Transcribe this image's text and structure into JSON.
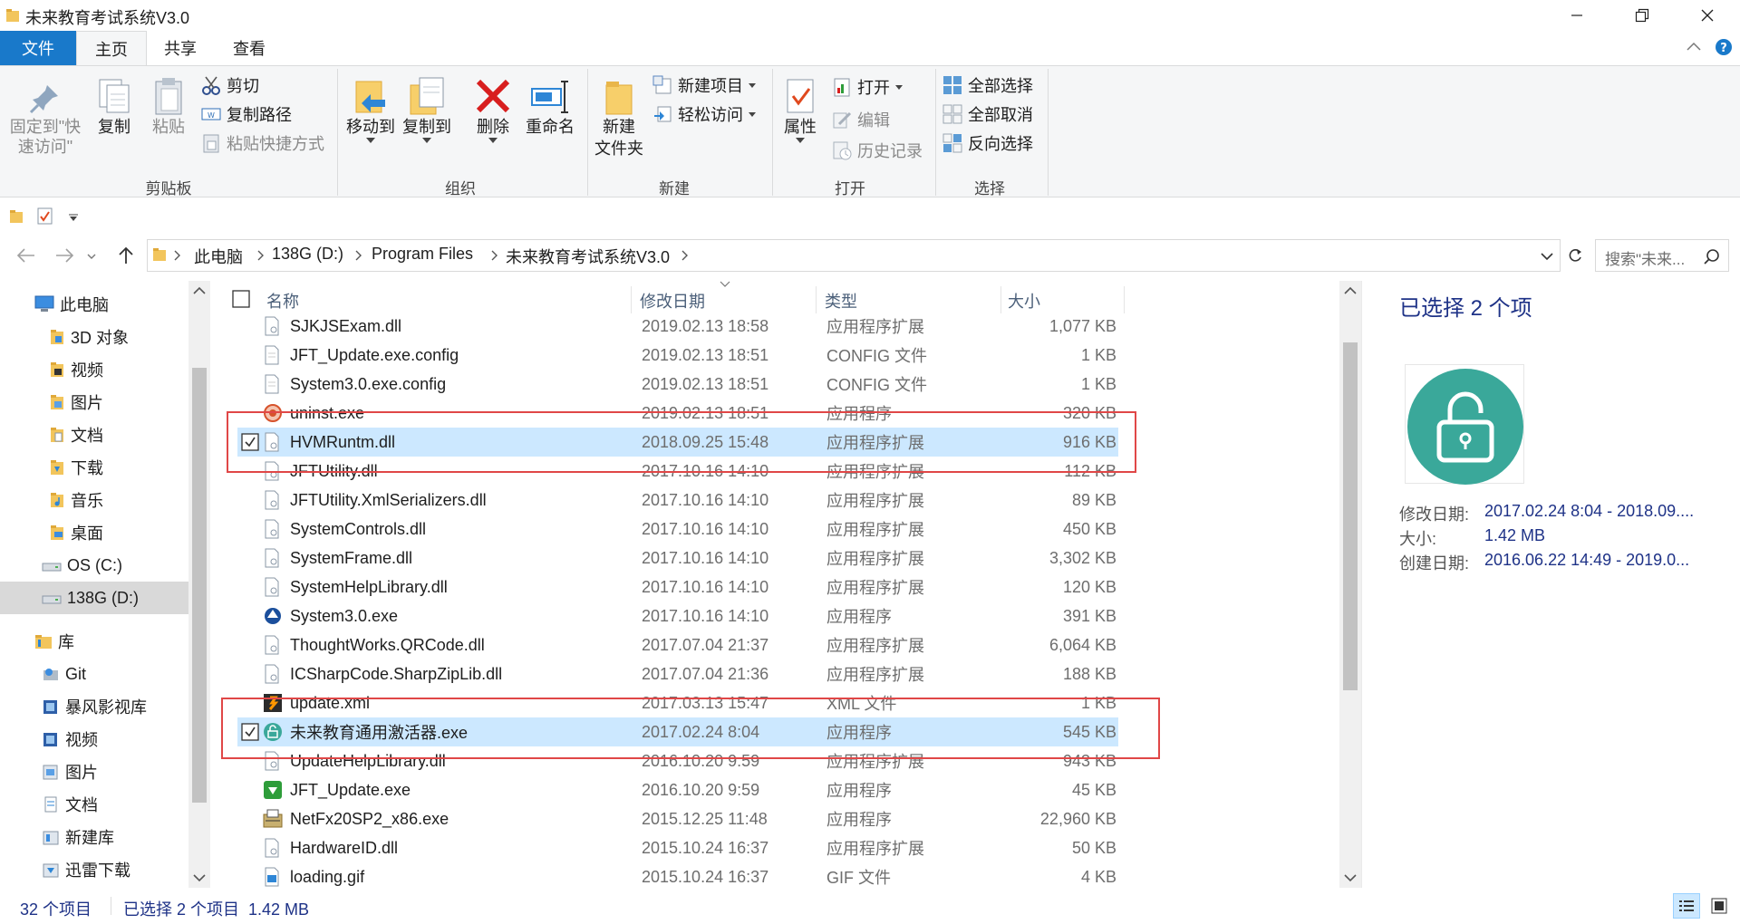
{
  "window": {
    "title": "未来教育考试系统V3.0"
  },
  "tabs": {
    "file": "文件",
    "home": "主页",
    "share": "共享",
    "view": "查看"
  },
  "ribbon": {
    "clipboard": {
      "label": "剪贴板",
      "pin_line1": "固定到\"快",
      "pin_line2": "速访问\"",
      "copy": "复制",
      "paste": "粘贴",
      "cut": "剪切",
      "copy_path": "复制路径",
      "paste_shortcut": "粘贴快捷方式"
    },
    "organize": {
      "label": "组织",
      "move_to": "移动到",
      "copy_to": "复制到",
      "delete": "删除",
      "rename": "重命名"
    },
    "new": {
      "label": "新建",
      "new_folder_line1": "新建",
      "new_folder_line2": "文件夹",
      "new_item": "新建项目",
      "easy_access": "轻松访问"
    },
    "open": {
      "label": "打开",
      "properties": "属性",
      "open": "打开",
      "edit": "编辑",
      "history": "历史记录"
    },
    "select": {
      "label": "选择",
      "select_all": "全部选择",
      "select_none": "全部取消",
      "invert": "反向选择"
    }
  },
  "address": {
    "crumbs": [
      "此电脑",
      "138G (D:)",
      "Program Files",
      "未来教育考试系统V3.0"
    ],
    "search_placeholder": "搜索\"未来..."
  },
  "nav": {
    "items": [
      {
        "label": "此电脑",
        "icon": "computer-icon"
      },
      {
        "label": "3D 对象",
        "icon": "folder-3d-icon"
      },
      {
        "label": "视频",
        "icon": "folder-video-icon"
      },
      {
        "label": "图片",
        "icon": "folder-pictures-icon"
      },
      {
        "label": "文档",
        "icon": "folder-documents-icon"
      },
      {
        "label": "下载",
        "icon": "folder-downloads-icon"
      },
      {
        "label": "音乐",
        "icon": "folder-music-icon"
      },
      {
        "label": "桌面",
        "icon": "folder-desktop-icon"
      },
      {
        "label": "OS (C:)",
        "icon": "drive-icon"
      },
      {
        "label": "138G (D:)",
        "icon": "drive-icon"
      },
      {
        "label": "库",
        "icon": "library-icon"
      },
      {
        "label": "Git",
        "icon": "git-icon"
      },
      {
        "label": "暴风影视库",
        "icon": "video-library-icon"
      },
      {
        "label": "视频",
        "icon": "video-library-icon"
      },
      {
        "label": "图片",
        "icon": "picture-library-icon"
      },
      {
        "label": "文档",
        "icon": "document-library-icon"
      },
      {
        "label": "新建库",
        "icon": "new-library-icon"
      },
      {
        "label": "迅雷下载",
        "icon": "download-library-icon"
      }
    ]
  },
  "columns": {
    "name": "名称",
    "date": "修改日期",
    "type": "类型",
    "size": "大小"
  },
  "files": [
    {
      "name": "SJKJSExam.dll",
      "date": "2019.02.13 18:58",
      "type": "应用程序扩展",
      "size": "1,077 KB",
      "icon": "dll-icon"
    },
    {
      "name": "JFT_Update.exe.config",
      "date": "2019.02.13 18:51",
      "type": "CONFIG 文件",
      "size": "1 KB",
      "icon": "file-icon"
    },
    {
      "name": "System3.0.exe.config",
      "date": "2019.02.13 18:51",
      "type": "CONFIG 文件",
      "size": "1 KB",
      "icon": "file-icon"
    },
    {
      "name": "uninst.exe",
      "date": "2019.02.13 18:51",
      "type": "应用程序",
      "size": "320 KB",
      "icon": "uninstaller-icon"
    },
    {
      "name": "HVMRuntm.dll",
      "date": "2018.09.25 15:48",
      "type": "应用程序扩展",
      "size": "916 KB",
      "icon": "dll-icon",
      "selected": true
    },
    {
      "name": "JFTUtility.dll",
      "date": "2017.10.16 14:10",
      "type": "应用程序扩展",
      "size": "112 KB",
      "icon": "dll-icon"
    },
    {
      "name": "JFTUtility.XmlSerializers.dll",
      "date": "2017.10.16 14:10",
      "type": "应用程序扩展",
      "size": "89 KB",
      "icon": "dll-icon"
    },
    {
      "name": "SystemControls.dll",
      "date": "2017.10.16 14:10",
      "type": "应用程序扩展",
      "size": "450 KB",
      "icon": "dll-icon"
    },
    {
      "name": "SystemFrame.dll",
      "date": "2017.10.16 14:10",
      "type": "应用程序扩展",
      "size": "3,302 KB",
      "icon": "dll-icon"
    },
    {
      "name": "SystemHelpLibrary.dll",
      "date": "2017.10.16 14:10",
      "type": "应用程序扩展",
      "size": "120 KB",
      "icon": "dll-icon"
    },
    {
      "name": "System3.0.exe",
      "date": "2017.10.16 14:10",
      "type": "应用程序",
      "size": "391 KB",
      "icon": "app-exe-icon"
    },
    {
      "name": "ThoughtWorks.QRCode.dll",
      "date": "2017.07.04 21:37",
      "type": "应用程序扩展",
      "size": "6,064 KB",
      "icon": "dll-icon"
    },
    {
      "name": "ICSharpCode.SharpZipLib.dll",
      "date": "2017.07.04 21:36",
      "type": "应用程序扩展",
      "size": "188 KB",
      "icon": "dll-icon"
    },
    {
      "name": "update.xml",
      "date": "2017.03.13 15:47",
      "type": "XML 文件",
      "size": "1 KB",
      "icon": "xml-file-icon"
    },
    {
      "name": "未来教育通用激活器.exe",
      "date": "2017.02.24 8:04",
      "type": "应用程序",
      "size": "545 KB",
      "icon": "activator-icon",
      "selected": true
    },
    {
      "name": "UpdateHelpLibrary.dll",
      "date": "2016.10.20 9:59",
      "type": "应用程序扩展",
      "size": "943 KB",
      "icon": "dll-icon"
    },
    {
      "name": "JFT_Update.exe",
      "date": "2016.10.20 9:59",
      "type": "应用程序",
      "size": "45 KB",
      "icon": "update-exe-icon"
    },
    {
      "name": "NetFx20SP2_x86.exe",
      "date": "2015.12.25 11:48",
      "type": "应用程序",
      "size": "22,960 KB",
      "icon": "installer-icon"
    },
    {
      "name": "HardwareID.dll",
      "date": "2015.10.24 16:37",
      "type": "应用程序扩展",
      "size": "50 KB",
      "icon": "dll-icon"
    },
    {
      "name": "loading.gif",
      "date": "2015.10.24 16:37",
      "type": "GIF 文件",
      "size": "4 KB",
      "icon": "image-file-icon"
    }
  ],
  "details": {
    "title": "已选择 2 个项",
    "rows": [
      {
        "label": "修改日期:",
        "value": "2017.02.24 8:04 - 2018.09...."
      },
      {
        "label": "大小:",
        "value": "1.42 MB"
      },
      {
        "label": "创建日期:",
        "value": "2016.06.22 14:49 - 2019.0..."
      }
    ]
  },
  "status": {
    "count": "32 个项目",
    "selection": "已选择 2 个项目  1.42 MB"
  },
  "colors": {
    "accent": "#1979ca",
    "selection": "#cce8ff",
    "highlight_box": "#e04747",
    "lock_circle": "#3aa89a"
  }
}
